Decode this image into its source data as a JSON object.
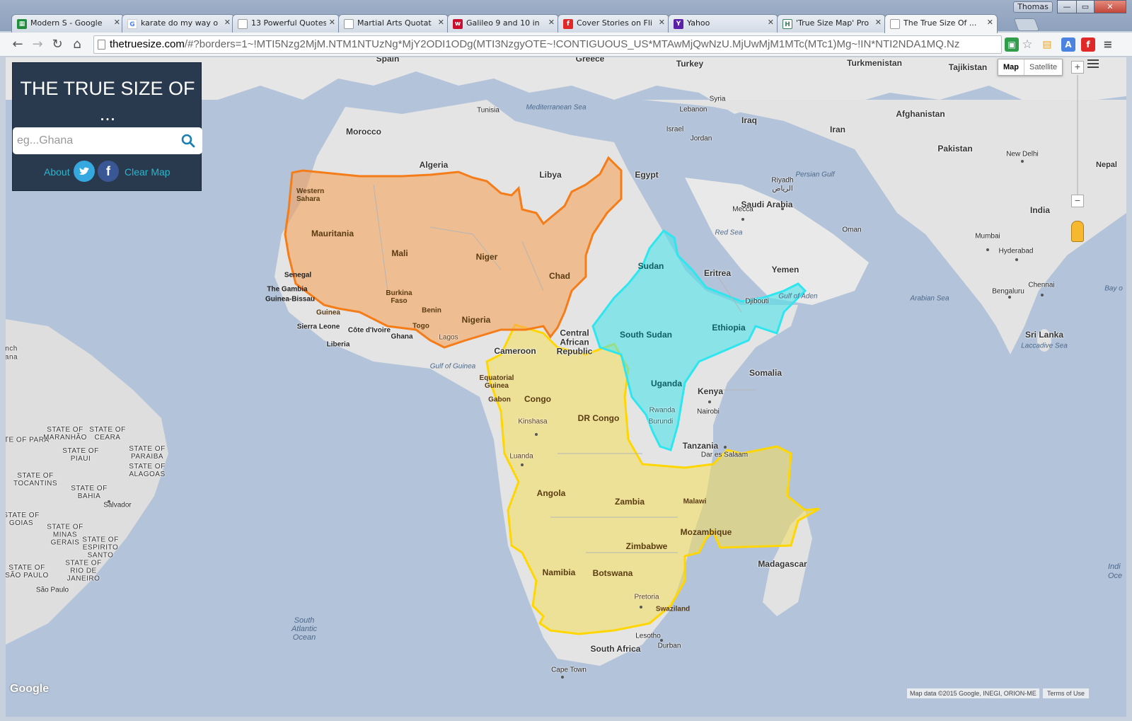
{
  "browser": {
    "profile_name": "Thomas",
    "tabs": [
      {
        "label": "Modern S - Google",
        "favicon_color": "#1e8e3e",
        "favicon_glyph": "▦"
      },
      {
        "label": "karate do my way o",
        "favicon_color": "#ffffff",
        "favicon_glyph": "G"
      },
      {
        "label": "13 Powerful Quotes",
        "favicon_color": "#ffffff",
        "favicon_glyph": ""
      },
      {
        "label": "Martial Arts Quotat",
        "favicon_color": "#ffffff",
        "favicon_glyph": ""
      },
      {
        "label": "Galileo 9 and 10 in",
        "favicon_color": "#c8102e",
        "favicon_glyph": "w"
      },
      {
        "label": "Cover Stories on Fli",
        "favicon_color": "#e12828",
        "favicon_glyph": "f"
      },
      {
        "label": "Yahoo",
        "favicon_color": "#5c1fa8",
        "favicon_glyph": "Y"
      },
      {
        "label": "'True Size Map' Pro",
        "favicon_color": "#3a7f5f",
        "favicon_glyph": "H"
      },
      {
        "label": "The True Size Of ...",
        "favicon_color": "#ffffff",
        "favicon_glyph": ""
      }
    ],
    "active_tab_index": 8,
    "url_host": "thetruesize.com",
    "url_path": "/#?borders=1~!MTI5Nzg2MjM.NTM1NTUzNg*MjY2ODI1ODg(MTI3NzgyOTE~!CONTIGUOUS_US*MTAwMjQwNzU.MjUwMjM1MTc(MTc1)Mg~!IN*NTI2NDA1MQ.Nz",
    "tab_close_glyph": "✕",
    "window_buttons": [
      "—",
      "▭",
      "✕"
    ]
  },
  "panel": {
    "title": "THE TRUE SIZE OF ...",
    "search_placeholder": "eg...Ghana",
    "about_label": "About",
    "facebook_glyph": "f",
    "clear_map_label": "Clear Map"
  },
  "map_controls": {
    "map_label": "Map",
    "satellite_label": "Satellite",
    "zoom_in": "+",
    "zoom_out": "−",
    "google_logo": "Google",
    "attribution": "Map data ©2015 Google, INEGI, ORION-ME",
    "terms": "Terms of Use"
  },
  "overlays": [
    {
      "name": "CONTIGUOUS_US",
      "color": "#f7a35b"
    },
    {
      "name": "IN",
      "color": "#4fe3e8"
    },
    {
      "name": "yellow-shape",
      "color": "#f4df5a"
    }
  ],
  "labels": {
    "countries": [
      "Spain",
      "Greece",
      "Turkey",
      "Turkmenistan",
      "Tajikistan",
      "Tunisia",
      "Syria",
      "Lebanon",
      "Iraq",
      "Afghanistan",
      "Morocco",
      "Israel",
      "Jordan",
      "Iran",
      "Pakistan",
      "Algeria",
      "Libya",
      "Egypt",
      "Western Sahara",
      "Saudi Arabia",
      "Mauritania",
      "Mali",
      "Niger",
      "Chad",
      "Sudan",
      "Eritrea",
      "Yemen",
      "Oman",
      "Senegal",
      "The Gambia",
      "Guinea-Bissau",
      "Guinea",
      "Burkina Faso",
      "Benin",
      "Sierra Leone",
      "Côte d'Ivoire",
      "Liberia",
      "Ghana",
      "Togo",
      "Nigeria",
      "Central African Republic",
      "South Sudan",
      "Ethiopia",
      "Djibouti",
      "Cameroon",
      "Equatorial Guinea",
      "Gabon",
      "Congo",
      "DR Congo",
      "Uganda",
      "Somalia",
      "Kenya",
      "Rwanda",
      "Burundi",
      "Tanzania",
      "Angola",
      "Zambia",
      "Malawi",
      "Mozambique",
      "Zimbabwe",
      "Namibia",
      "Botswana",
      "Madagascar",
      "Swaziland",
      "Lesotho",
      "South Africa",
      "India",
      "Sri Lanka",
      "Nepal"
    ],
    "cities": [
      "Riyadh",
      "الرياض",
      "Mecca",
      "New Delhi",
      "Mumbai",
      "Hyderabad",
      "Bengaluru",
      "Chennai",
      "Kinshasa",
      "Luanda",
      "Nairobi",
      "Dar es Salaam",
      "Pretoria",
      "Durban",
      "Cape Town",
      "Lagos",
      "Salvador",
      "São Paulo"
    ],
    "water": [
      "Mediterranean Sea",
      "Persian Gulf",
      "Red Sea",
      "Gulf of Aden",
      "Arabian Sea",
      "Gulf of Guinea",
      "Laccadive Sea",
      "Bay o",
      "South Atlantic Ocean",
      "Indi Oce"
    ],
    "brazil_states": [
      "STATE OF PARA",
      "STATE OF MARANHÃO",
      "STATE OF CEARA",
      "STATE OF PIAUI",
      "STATE OF PARAIBA",
      "STATE OF ALAGOAS",
      "STATE OF TOCANTINS",
      "STATE OF BAHIA",
      "STATE OF GOIAS",
      "STATE OF MINAS GERAIS",
      "STATE OF ESPIRITO SANTO",
      "STATE OF RIO DE JANEIRO",
      "STATE OF SÃO PAULO",
      "nch",
      "ana"
    ]
  }
}
